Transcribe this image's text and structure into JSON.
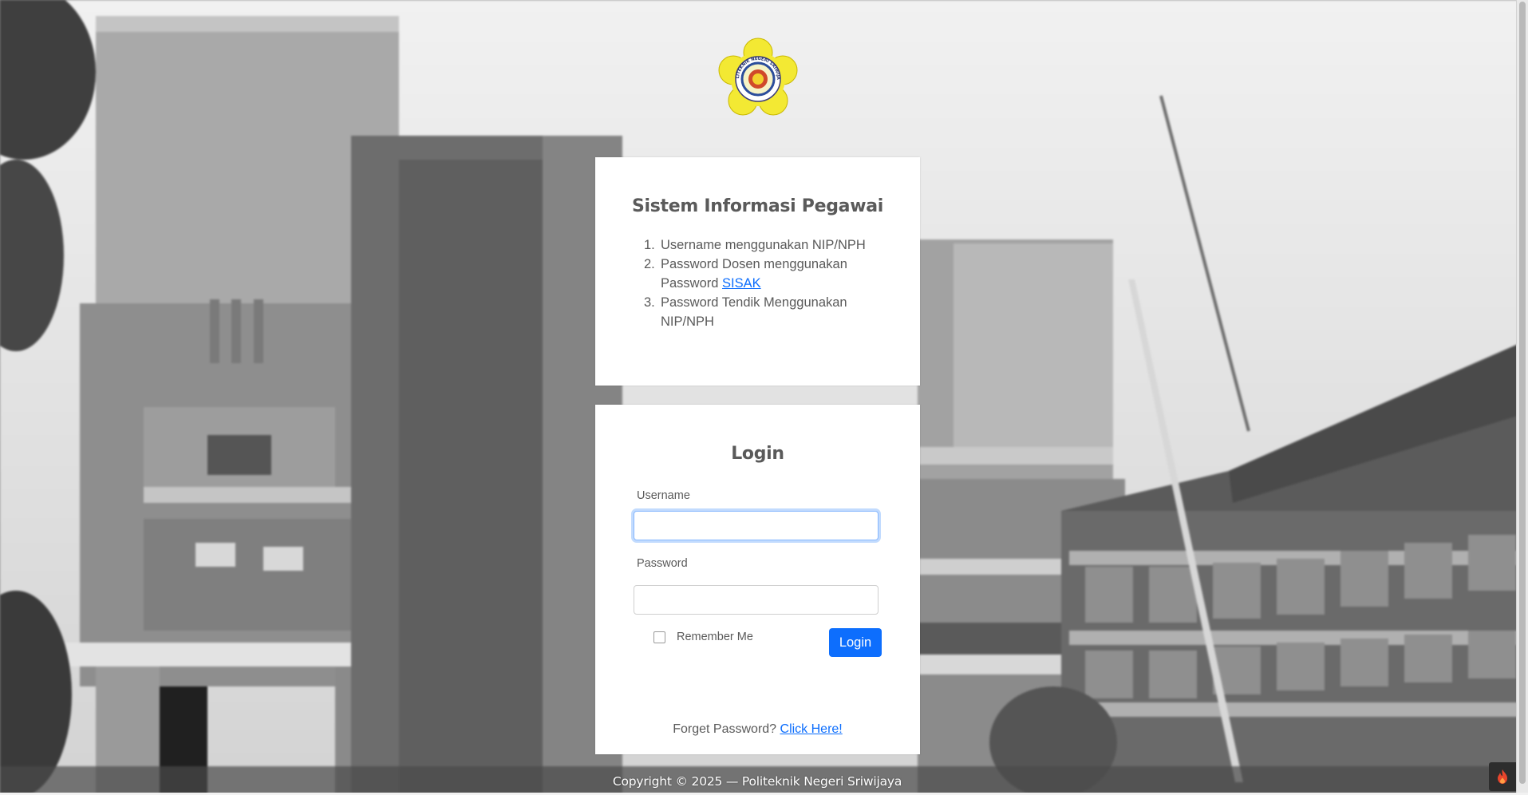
{
  "info_card": {
    "title": "Sistem Informasi Pegawai",
    "rules": [
      {
        "num": "1.",
        "text": "Username menggunakan NIP/NPH"
      },
      {
        "num": "2.",
        "text_before": "Password Dosen menggunakan Password ",
        "link": "SISAK"
      },
      {
        "num": "3.",
        "text": "Password Tendik Menggunakan NIP/NPH"
      }
    ]
  },
  "login_card": {
    "title": "Login",
    "username_label": "Username",
    "username_value": "",
    "password_label": "Password",
    "password_value": "",
    "remember_label": "Remember Me",
    "remember_checked": false,
    "login_button": "Login",
    "forgot_text": "Forget Password? ",
    "forgot_link": "Click Here!"
  },
  "footer": {
    "text": "Copyright © 2025 — Politeknik Negeri Sriwijaya"
  },
  "logo": {
    "name": "polsri-logo",
    "arc_text": "POLITEKNIK NEGERI SRIWIJAYA"
  },
  "colors": {
    "primary": "#0d6efd",
    "logo_yellow": "#f3e933",
    "text": "#5a5a5a"
  }
}
